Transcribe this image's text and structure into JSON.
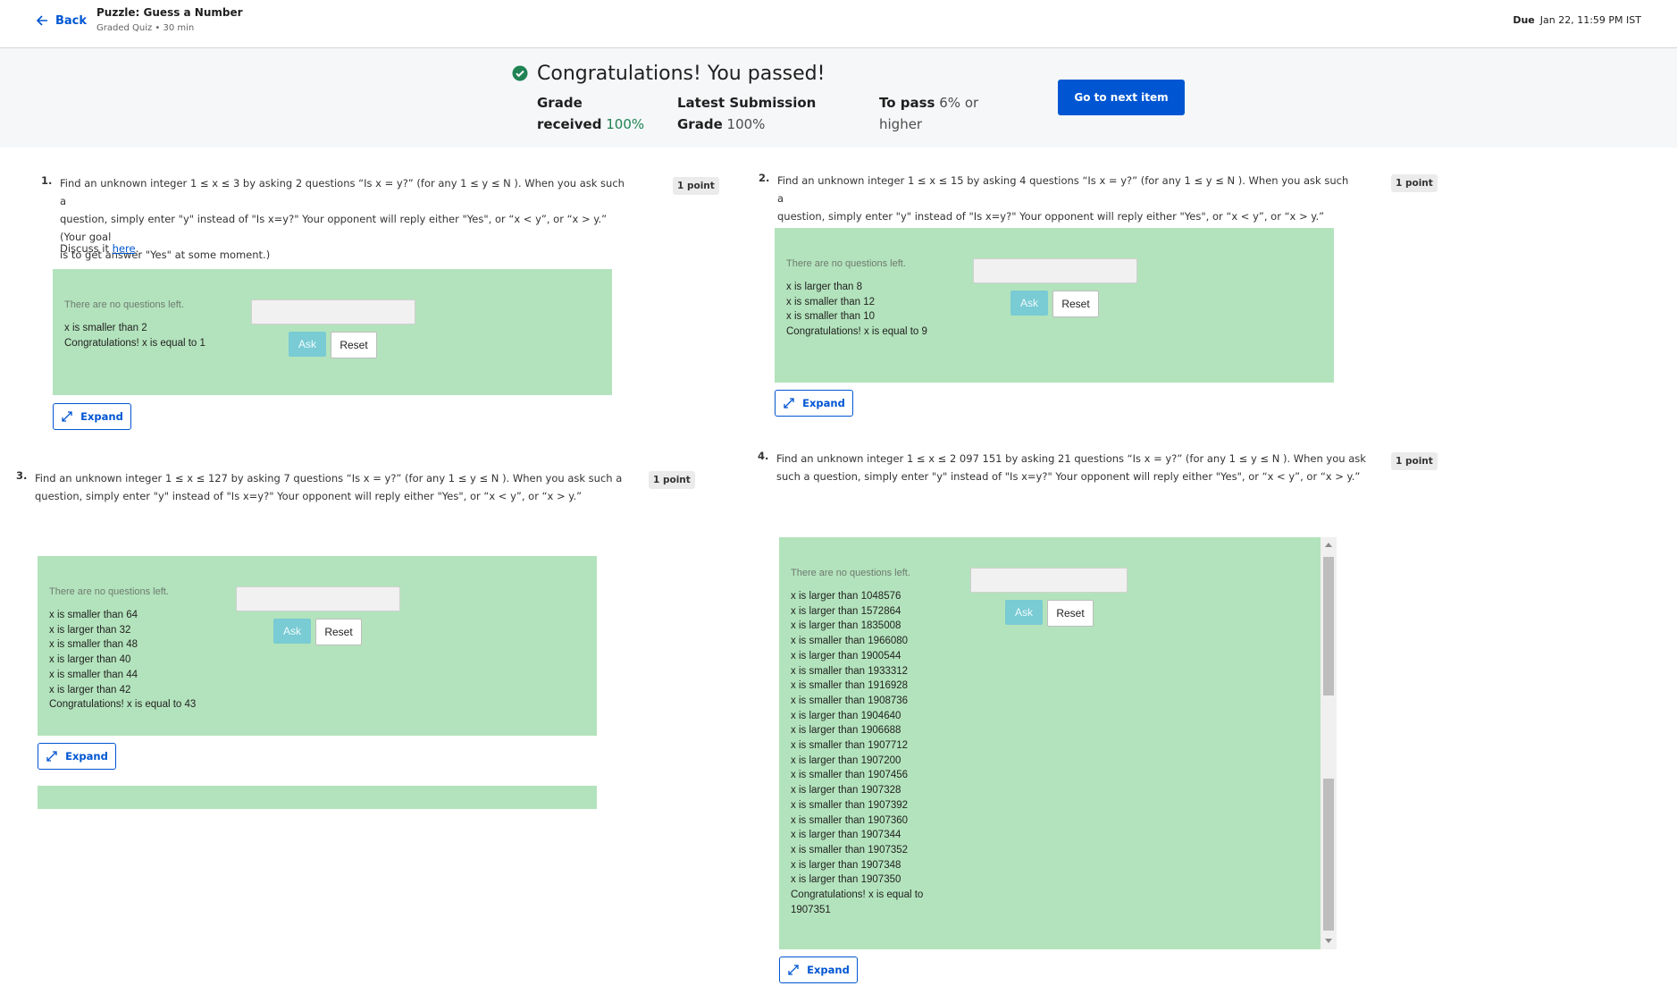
{
  "header": {
    "back_label": "Back",
    "title": "Puzzle: Guess a Number",
    "subtitle": "Graded Quiz • 30 min",
    "due_label": "Due",
    "due_date": "Jan 22, 11:59 PM IST"
  },
  "banner": {
    "heading": "Congratulations! You passed!",
    "grade_label_1": "Grade",
    "grade_label_2": "received",
    "grade_value": "100%",
    "latest_label_1": "Latest Submission",
    "latest_label_2": "Grade",
    "latest_value": "100%",
    "pass_label": "To pass",
    "pass_value_1": "6% or",
    "pass_value_2": "higher",
    "next_button": "Go to next item",
    "colors": {
      "accent": "#0056d2",
      "success": "#1f8354",
      "widget_bg": "#b3e3bc"
    }
  },
  "questions": [
    {
      "num": "1.",
      "points": "1 point",
      "lines": [
        "Find an unknown integer 1 ≤ x ≤ 3 by asking 2 questions “Is x = y?” (for any 1 ≤ y ≤ N ). When you ask such a",
        "question, simply enter \"y\" instead of \"Is x=y?\" Your opponent will reply either \"Yes\", or “x < y”, or “x > y.” (Your goal",
        "is to get answer \"Yes\" at some moment.)"
      ],
      "discuss_prefix": "Discuss it ",
      "discuss_link": "here",
      "discuss_suffix": ".",
      "no_questions": "There are no questions left.",
      "log": [
        "x is smaller than 2",
        "Congratulations! x is equal to 1"
      ],
      "ask": "Ask",
      "reset": "Reset",
      "expand": "Expand"
    },
    {
      "num": "2.",
      "points": "1 point",
      "lines": [
        "Find an unknown integer 1 ≤ x ≤ 15 by asking 4 questions “Is x = y?” (for any 1 ≤ y ≤ N ). When you ask such a",
        "question, simply enter \"y\" instead of \"Is x=y?\" Your opponent will reply either \"Yes\", or “x < y”, or “x > y.”"
      ],
      "no_questions": "There are no questions left.",
      "log": [
        "x is larger than 8",
        "x is smaller than 12",
        "x is smaller than 10",
        "Congratulations! x is equal to 9"
      ],
      "ask": "Ask",
      "reset": "Reset",
      "expand": "Expand"
    },
    {
      "num": "3.",
      "points": "1 point",
      "lines": [
        "Find an unknown integer 1 ≤ x ≤ 127 by asking 7 questions “Is x = y?” (for any 1 ≤ y ≤ N ). When you ask such a",
        "question, simply enter \"y\" instead of \"Is x=y?\" Your opponent will reply either \"Yes\", or “x < y”, or “x > y.”"
      ],
      "no_questions": "There are no questions left.",
      "log": [
        "x is smaller than 64",
        "x is larger than 32",
        "x is smaller than 48",
        "x is larger than 40",
        "x is smaller than 44",
        "x is larger than 42",
        "Congratulations! x is equal to 43"
      ],
      "ask": "Ask",
      "reset": "Reset",
      "expand": "Expand"
    },
    {
      "num": "4.",
      "points": "1 point",
      "lines": [
        "Find an unknown integer 1 ≤ x ≤ 2 097 151 by asking 21 questions “Is x = y?” (for any 1 ≤ y ≤ N ). When you ask",
        "such a question, simply enter \"y\" instead of \"Is x=y?\" Your opponent will reply either \"Yes\", or “x < y”, or “x > y.”"
      ],
      "no_questions": "There are no questions left.",
      "log": [
        "x is larger than 1048576",
        "x is larger than 1572864",
        "x is larger than 1835008",
        "x is smaller than 1966080",
        "x is larger than 1900544",
        "x is smaller than 1933312",
        "x is smaller than 1916928",
        "x is smaller than 1908736",
        "x is larger than 1904640",
        "x is larger than 1906688",
        "x is smaller than 1907712",
        "x is larger than 1907200",
        "x is smaller than 1907456",
        "x is larger than 1907328",
        "x is smaller than 1907392",
        "x is smaller than 1907360",
        "x is larger than 1907344",
        "x is smaller than 1907352",
        "x is larger than 1907348",
        "x is larger than 1907350",
        "Congratulations! x is equal to",
        "1907351"
      ],
      "ask": "Ask",
      "reset": "Reset",
      "expand": "Expand"
    }
  ]
}
